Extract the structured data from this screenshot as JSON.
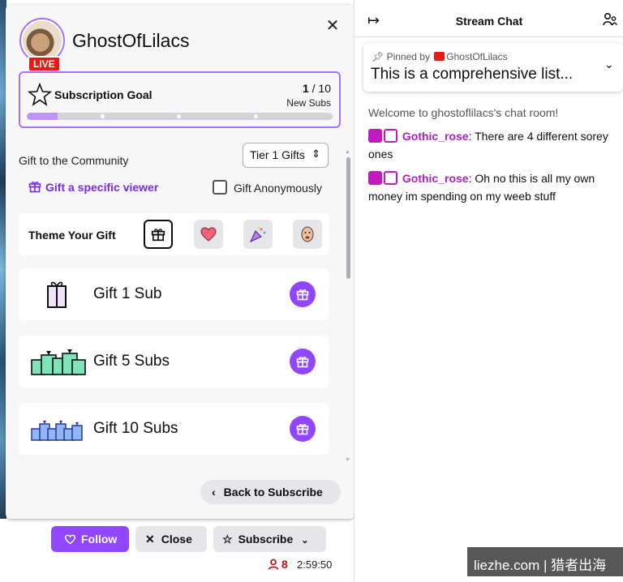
{
  "channel": {
    "name": "GhostOfLilacs",
    "live_label": "LIVE",
    "close_glyph": "✕"
  },
  "goal": {
    "title": "Subscription Goal",
    "current": "1",
    "separator": " / ",
    "target": "10",
    "unit": "New Subs",
    "progress_fraction": 0.1
  },
  "gifting": {
    "community_label": "Gift to the Community",
    "tier_value": "Tier 1 Gifts",
    "specific_viewer": "Gift a specific viewer",
    "anonymous_label": "Gift Anonymously",
    "theme_label": "Theme Your Gift",
    "options": [
      {
        "label": "Gift 1 Sub"
      },
      {
        "label": "Gift 5 Subs"
      },
      {
        "label": "Gift 10 Subs"
      }
    ],
    "back_label": "Back to Subscribe"
  },
  "actions": {
    "follow": "Follow",
    "close": "Close",
    "subscribe": "Subscribe"
  },
  "stats": {
    "viewers": "8",
    "uptime": "2:59:50"
  },
  "chat": {
    "title": "Stream Chat",
    "pinned_by": "Pinned by",
    "pinned_user": "GhostOfLilacs",
    "pinned_text": "This is a comprehensive list...",
    "welcome": "Welcome to ghostoflilacs's chat room!",
    "messages": [
      {
        "user": "Gothic_rose",
        "text": ": There are 4 different sorey ones"
      },
      {
        "user": "Gothic_rose",
        "text": ": Oh no this is all my own money im spending on my weeb stuff"
      }
    ]
  },
  "watermark": "liezhe.com | 猎者出海",
  "colors": {
    "accent": "#9147ff",
    "accent_light": "#a970ff",
    "live": "#e91916",
    "chat_user": "#b11fbf"
  },
  "icons": [
    "close-icon",
    "star-icon",
    "gift-icon",
    "heart-icon",
    "celebrate-icon",
    "emote-icon",
    "chevron-left-icon",
    "chevron-down-icon",
    "collapse-icon",
    "users-icon",
    "pin-icon",
    "person-icon"
  ]
}
